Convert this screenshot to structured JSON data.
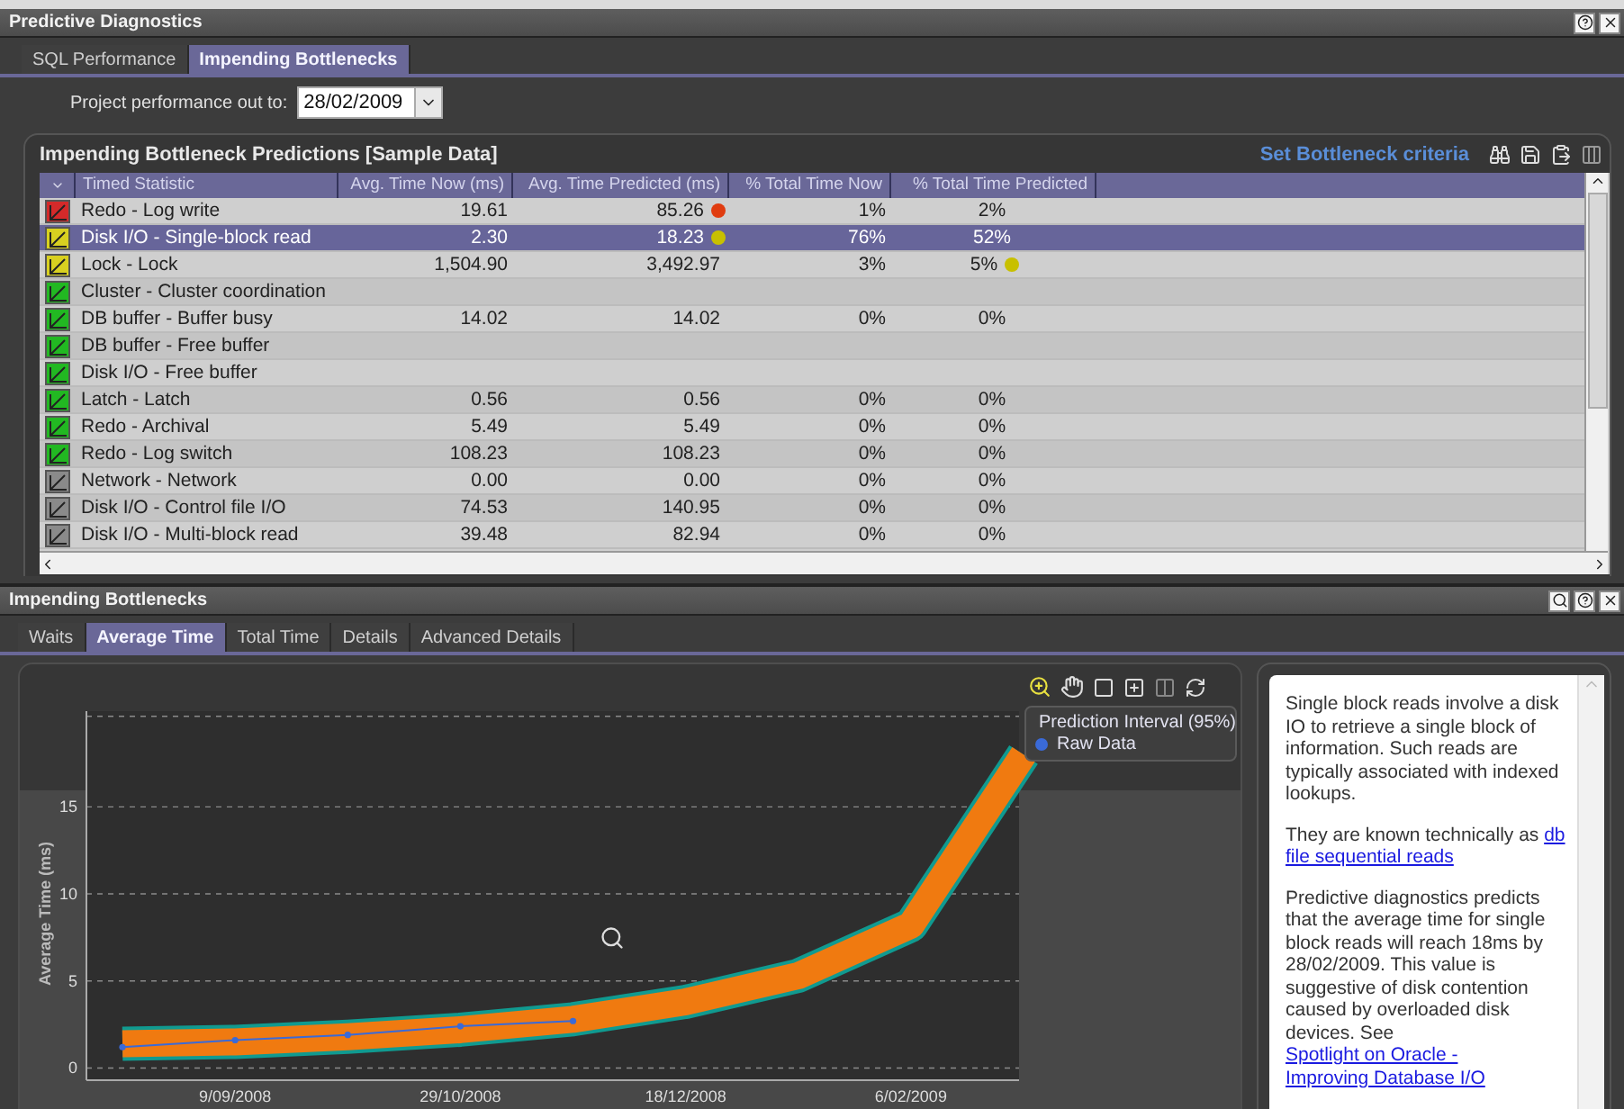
{
  "panel": {
    "title": "Predictive Diagnostics"
  },
  "tabs": [
    {
      "label": "SQL Performance",
      "selected": false
    },
    {
      "label": "Impending Bottlenecks",
      "selected": true
    }
  ],
  "projection": {
    "label": "Project performance out to:",
    "value": "28/02/2009"
  },
  "grid": {
    "title": "Impending Bottleneck Predictions [Sample Data]",
    "criteria_link": "Set Bottleneck criteria",
    "columns": [
      "Timed Statistic",
      "Avg. Time Now (ms)",
      "Avg. Time Predicted (ms)",
      "% Total Time Now",
      "% Total Time Predicted"
    ],
    "rows": [
      {
        "statistic": "Redo - Log write",
        "now": "19.61",
        "predicted": "85.26",
        "pct_now": "1%",
        "pct_predicted": "2%",
        "color": "#d42a2a",
        "predicted_flag": {
          "color": "#e03c10"
        },
        "selected": false
      },
      {
        "statistic": "Disk I/O - Single-block read",
        "now": "2.30",
        "predicted": "18.23",
        "pct_now": "76%",
        "pct_predicted": "52%",
        "color": "#d8d020",
        "predicted_flag": {
          "color": "#c8c000"
        },
        "selected": true
      },
      {
        "statistic": "Lock - Lock",
        "now": "1,504.90",
        "predicted": "3,492.97",
        "pct_now": "3%",
        "pct_predicted": "5%",
        "color": "#d8d020",
        "pct_flag": {
          "color": "#c8c000"
        },
        "selected": false
      },
      {
        "statistic": "Cluster - Cluster coordination",
        "color": "#22b822",
        "selected": false
      },
      {
        "statistic": "DB buffer - Buffer busy",
        "now": "14.02",
        "predicted": "14.02",
        "pct_now": "0%",
        "pct_predicted": "0%",
        "color": "#22b822",
        "selected": false
      },
      {
        "statistic": "DB buffer - Free buffer",
        "color": "#22b822",
        "selected": false
      },
      {
        "statistic": "Disk I/O - Free buffer",
        "color": "#22b822",
        "selected": false
      },
      {
        "statistic": "Latch - Latch",
        "now": "0.56",
        "predicted": "0.56",
        "pct_now": "0%",
        "pct_predicted": "0%",
        "color": "#22b822",
        "selected": false
      },
      {
        "statistic": "Redo - Archival",
        "now": "5.49",
        "predicted": "5.49",
        "pct_now": "0%",
        "pct_predicted": "0%",
        "color": "#22b822",
        "selected": false
      },
      {
        "statistic": "Redo - Log switch",
        "now": "108.23",
        "predicted": "108.23",
        "pct_now": "0%",
        "pct_predicted": "0%",
        "color": "#22b822",
        "selected": false
      },
      {
        "statistic": "Network - Network",
        "now": "0.00",
        "predicted": "0.00",
        "pct_now": "0%",
        "pct_predicted": "0%",
        "color": "#8a8a8a",
        "selected": false
      },
      {
        "statistic": "Disk I/O - Control file I/O",
        "now": "74.53",
        "predicted": "140.95",
        "pct_now": "0%",
        "pct_predicted": "0%",
        "color": "#8a8a8a",
        "selected": false
      },
      {
        "statistic": "Disk I/O - Multi-block read",
        "now": "39.48",
        "predicted": "82.94",
        "pct_now": "0%",
        "pct_predicted": "0%",
        "color": "#8a8a8a",
        "selected": false
      }
    ]
  },
  "bottom": {
    "title": "Impending Bottlenecks",
    "tabs": [
      {
        "label": "Waits",
        "selected": false
      },
      {
        "label": "Average Time",
        "selected": true
      },
      {
        "label": "Total Time",
        "selected": false
      },
      {
        "label": "Details",
        "selected": false
      },
      {
        "label": "Advanced Details",
        "selected": false
      }
    ],
    "chart_data": {
      "type": "line",
      "ylabel": "Average Time (ms)",
      "categories": [
        null,
        "9/09/2008",
        null,
        "29/10/2008",
        null,
        "18/12/2008",
        null,
        "6/02/2009",
        null
      ],
      "yticks": [
        0,
        5,
        10,
        15
      ],
      "ylim": [
        -0.7,
        20.5
      ],
      "grid": true,
      "series": [
        {
          "name": "Prediction Interval (95%)",
          "color": "#f07a10",
          "values": [
            1.4,
            1.5,
            1.8,
            2.2,
            2.8,
            3.8,
            5.3,
            8.2,
            18
          ]
        },
        {
          "name": "Raw Data",
          "color": "#3a6ad8",
          "marker": "o",
          "values": [
            1.2,
            1.6,
            1.9,
            2.4,
            2.7,
            null,
            null,
            null,
            null
          ]
        }
      ]
    },
    "info": [
      {
        "text": "Single block reads involve a disk IO to retrieve a single block of information. Such reads are typically associated with indexed lookups."
      },
      {
        "text": "They are known technically as ",
        "links": [
          "db",
          "file sequential reads"
        ]
      },
      {
        "text": "Predictive diagnostics predicts that the average time for single block reads will reach 18ms by 28/02/2009. This value is suggestive of disk contention caused by overloaded disk devices. See ",
        "links": [
          "Spotlight on Oracle -",
          "Improving Database I/O"
        ]
      }
    ]
  }
}
